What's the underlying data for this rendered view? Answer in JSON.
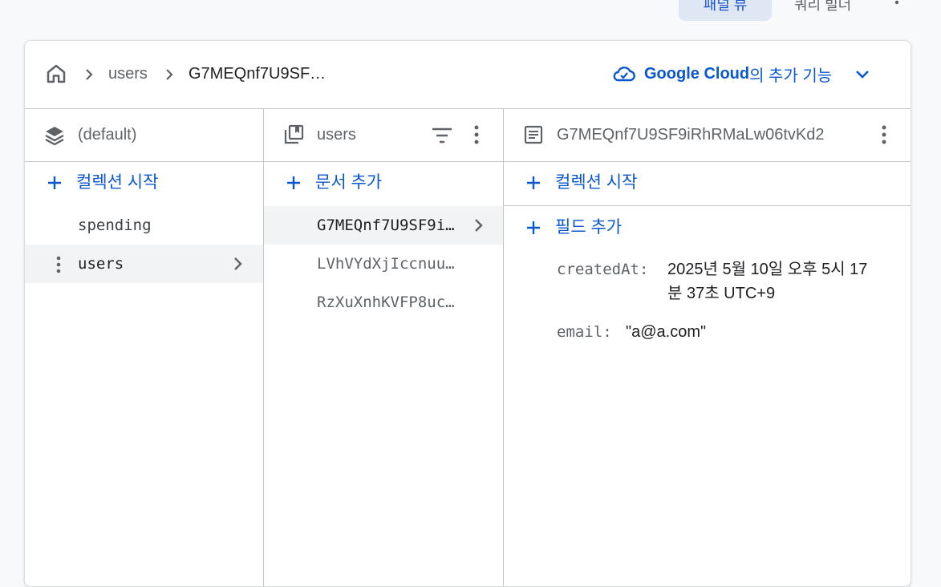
{
  "top": {
    "active_tab": "패널 뷰",
    "tab2": "쿼리 빌더"
  },
  "breadcrumb": {
    "collection": "users",
    "document": "G7MEQnf7U9SF…"
  },
  "google_cloud": {
    "brand": "Google Cloud",
    "rest": "의 추가 기능"
  },
  "panel_root": {
    "title": "(default)",
    "add_label": "컬렉션 시작",
    "items": [
      "spending",
      "users"
    ]
  },
  "panel_collection": {
    "title": "users",
    "add_label": "문서 추가",
    "items": [
      "G7MEQnf7U9SF9i…",
      "LVhVYdXjIccnuu…",
      "RzXuXnhKVFP8uc…"
    ]
  },
  "panel_document": {
    "title": "G7MEQnf7U9SF9iRhRMaLw06tvKd2",
    "add_collection_label": "컬렉션 시작",
    "add_field_label": "필드 추가",
    "fields": [
      {
        "key": "createdAt:",
        "value_line1": "2025년 5월 10일 오후 5시 17",
        "value_line2": "분 37초 UTC+9"
      },
      {
        "key": "email:",
        "value_line1": "\"a@a.com\""
      }
    ]
  },
  "colors": {
    "accent": "#0b57d0",
    "selected_bg": "#f1f3f4",
    "border": "#c4c7c5"
  }
}
